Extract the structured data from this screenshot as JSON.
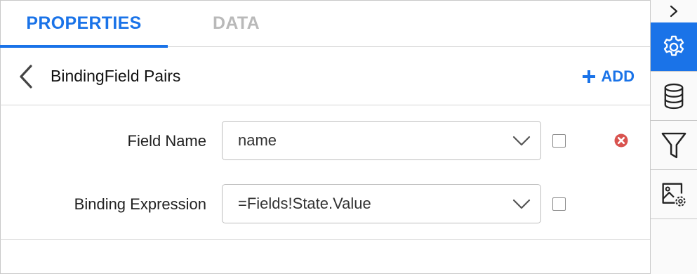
{
  "tabs": [
    {
      "label": "PROPERTIES",
      "active": true
    },
    {
      "label": "DATA",
      "active": false
    }
  ],
  "header": {
    "title": "BindingField Pairs",
    "add_label": "ADD"
  },
  "fields": [
    {
      "label": "Field Name",
      "value": "name",
      "checked": false,
      "removable": true
    },
    {
      "label": "Binding Expression",
      "value": "=Fields!State.Value",
      "checked": false,
      "removable": false
    }
  ],
  "rail": {
    "items": [
      {
        "icon": "gear-icon",
        "active": true
      },
      {
        "icon": "database-icon",
        "active": false
      },
      {
        "icon": "filter-icon",
        "active": false
      },
      {
        "icon": "image-settings-icon",
        "active": false
      }
    ]
  },
  "colors": {
    "accent": "#1a73e8",
    "inactive_tab": "#b9b9b9",
    "remove": "#d9534f"
  }
}
